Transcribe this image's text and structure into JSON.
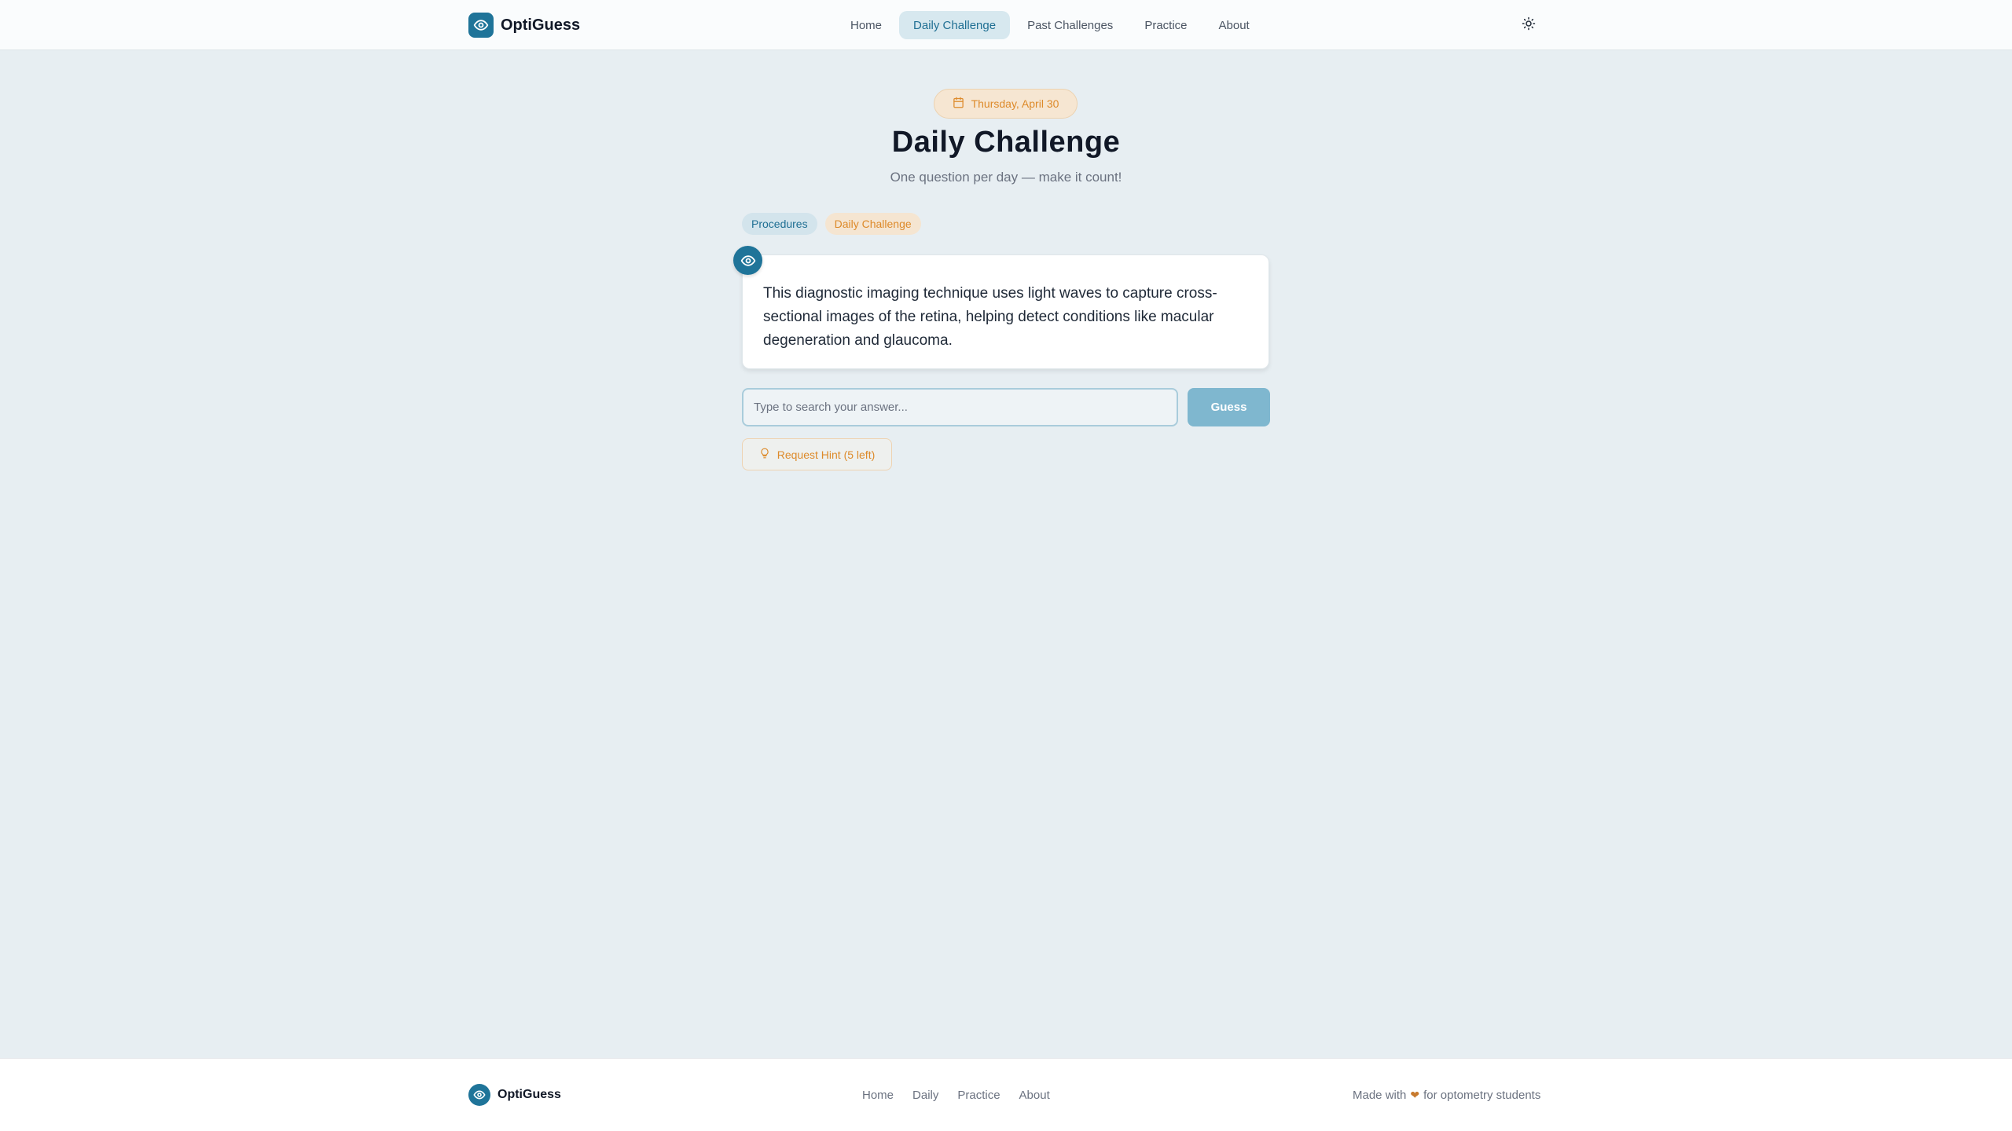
{
  "header": {
    "brand": "OptiGuess",
    "nav": [
      {
        "label": "Home",
        "active": false
      },
      {
        "label": "Daily Challenge",
        "active": true
      },
      {
        "label": "Past Challenges",
        "active": false
      },
      {
        "label": "Practice",
        "active": false
      },
      {
        "label": "About",
        "active": false
      }
    ],
    "theme_icon": "sun-icon"
  },
  "main": {
    "date": "Thursday, April 30",
    "title": "Daily Challenge",
    "subtitle": "One question per day — make it count!",
    "tags": [
      "Procedures",
      "Daily Challenge"
    ],
    "question": "This diagnostic imaging technique uses light waves to capture cross-sectional images of the retina, helping detect conditions like macular degeneration and glaucoma.",
    "input_placeholder": "Type to search your answer...",
    "input_value": "",
    "guess_label": "Guess",
    "hint_label": "Request Hint (5 left)"
  },
  "footer": {
    "brand": "OptiGuess",
    "links": [
      "Home",
      "Daily",
      "Practice",
      "About"
    ],
    "note_prefix": "Made with",
    "note_suffix": "for optometry students"
  },
  "colors": {
    "primary": "#1f7499",
    "accent": "#dd8a2a",
    "background": "#e7eef2"
  }
}
